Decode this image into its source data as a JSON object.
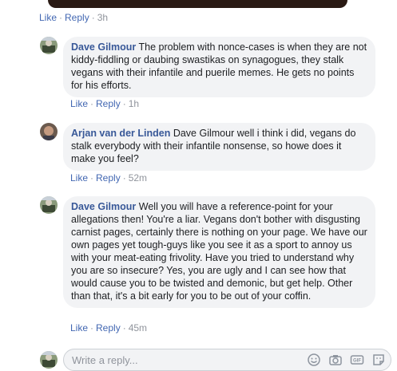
{
  "top": {
    "like_label": "Like",
    "reply_label": "Reply",
    "time": "3h"
  },
  "comments": [
    {
      "author": "Dave Gilmour",
      "text": "The problem with nonce-cases is when they are not kiddy-fiddling or daubing swastikas on synagogues, they stalk vegans with their infantile and puerile memes. He gets no points for his efforts.",
      "like_label": "Like",
      "reply_label": "Reply",
      "time": "1h"
    },
    {
      "author": "Arjan van der Linden",
      "text": "Dave Gilmour well i think i did, vegans do stalk everybody with their infantile nonsense, so howe does it make you feel?",
      "like_label": "Like",
      "reply_label": "Reply",
      "time": "52m"
    },
    {
      "author": "Dave Gilmour",
      "text": "Well you will have a reference-point for your allegations then! You're a liar. Vegans don't bother with disgusting carnist pages, certainly there is nothing on your page. We have our own pages yet tough-guys like you see it as a sport to annoy us with your meat-eating frivolity. Have you tried to understand why you are so insecure? Yes, you are ugly and I can see how that would cause you to be twisted and demonic, but get help. Other than that, it's a bit early for you to be out of your coffin.",
      "like_label": "Like",
      "reply_label": "Reply",
      "time": "45m"
    }
  ],
  "reply": {
    "placeholder": "Write a reply..."
  },
  "colors": {
    "link": "#4267b2",
    "author": "#385898",
    "bubble": "#f2f3f5",
    "meta": "#90949c"
  },
  "icons": [
    "emoji-icon",
    "camera-icon",
    "gif-icon",
    "sticker-icon"
  ]
}
